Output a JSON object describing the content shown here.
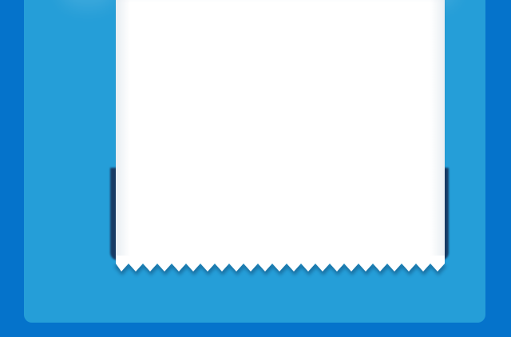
{
  "colors": {
    "background": "#0573cb",
    "panel": "#259ed8",
    "receipt": "#ffffff",
    "receipt_edge_shadow": "#17365f"
  },
  "icons": {
    "receipt": "receipt-icon"
  }
}
